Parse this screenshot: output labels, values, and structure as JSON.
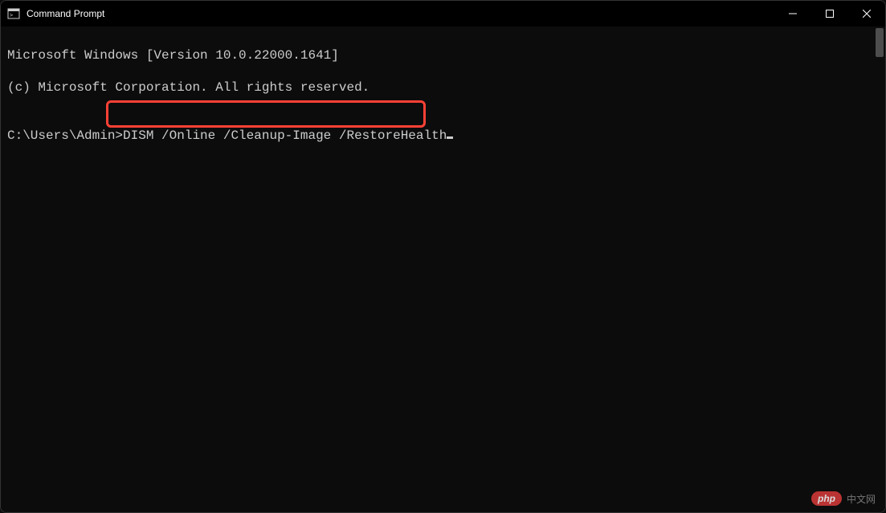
{
  "window": {
    "title": "Command Prompt"
  },
  "terminal": {
    "line1": "Microsoft Windows [Version 10.0.22000.1641]",
    "line2": "(c) Microsoft Corporation. All rights reserved.",
    "blank": "",
    "prompt": "C:\\Users\\Admin>",
    "command": "DISM /Online /Cleanup-Image /RestoreHealth"
  },
  "watermark": {
    "badge": "php",
    "text": "中文网"
  }
}
